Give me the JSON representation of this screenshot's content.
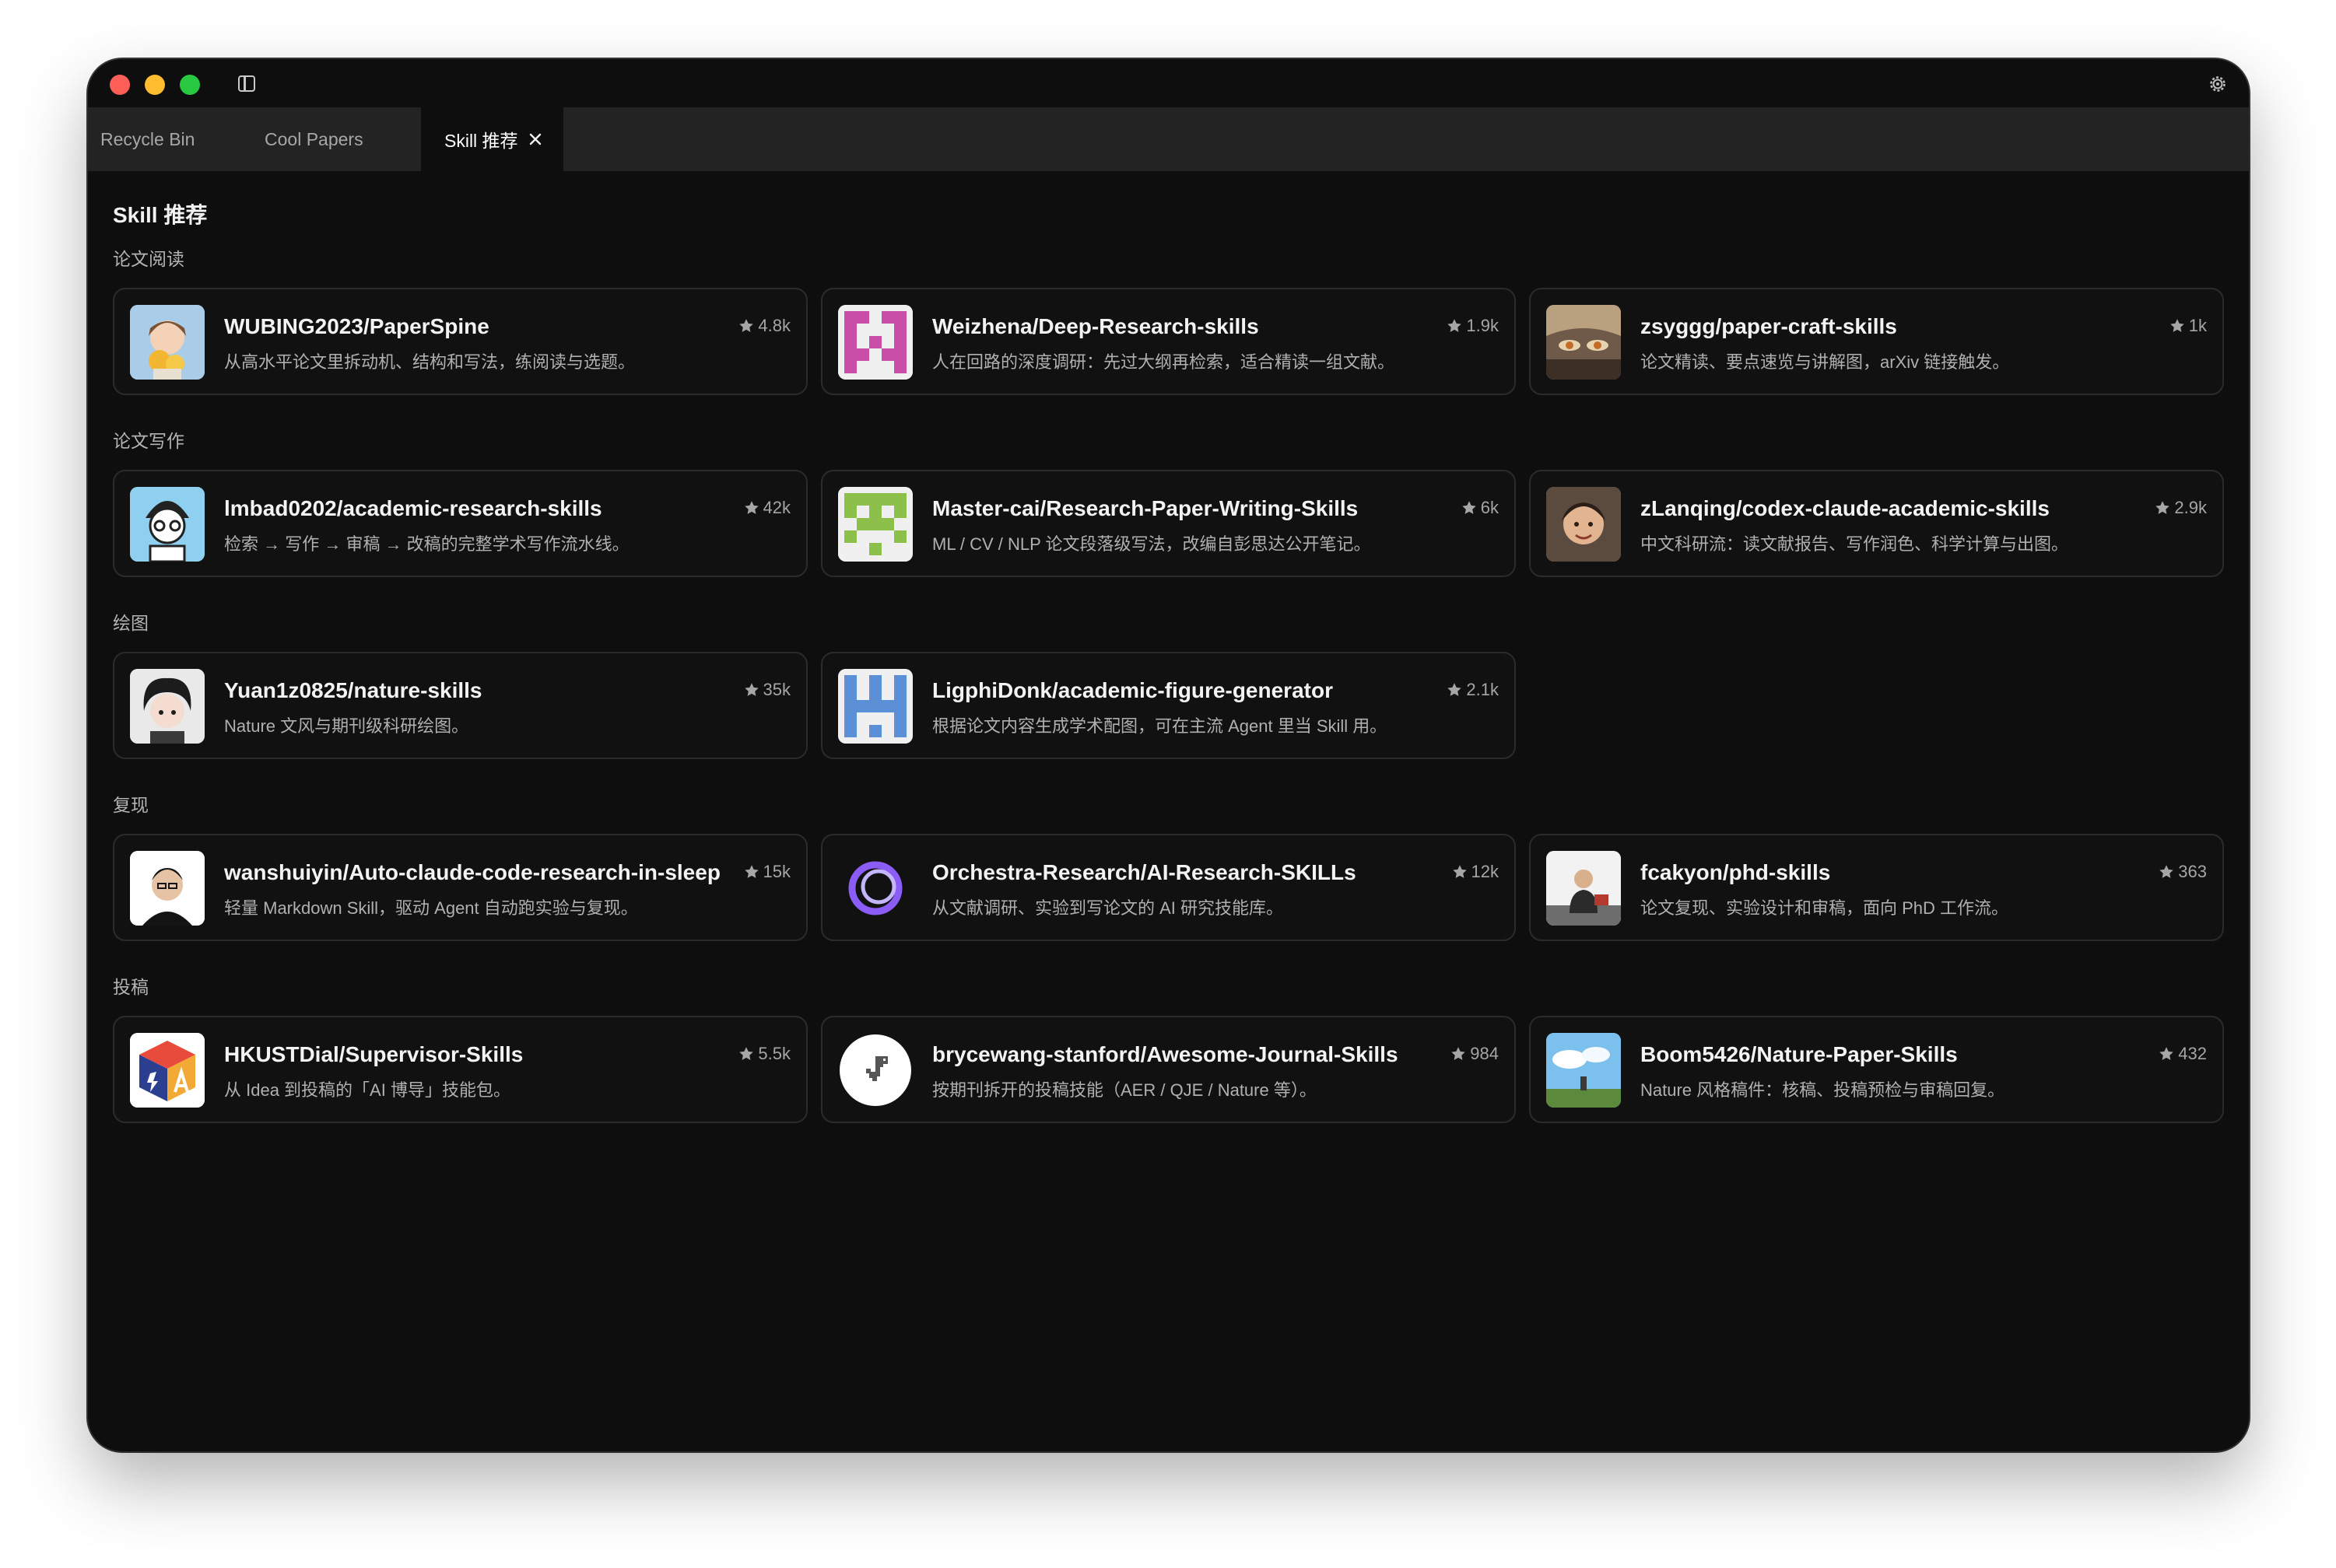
{
  "tabs": [
    {
      "label": "Recycle Bin"
    },
    {
      "label": "Cool Papers"
    },
    {
      "label": "Skill 推荐"
    }
  ],
  "page": {
    "title": "Skill 推荐"
  },
  "sections": [
    {
      "label": "论文阅读"
    },
    {
      "label": "论文写作"
    },
    {
      "label": "绘图"
    },
    {
      "label": "复现"
    },
    {
      "label": "投稿"
    }
  ],
  "cards": [
    {
      "title": "WUBING2023/PaperSpine",
      "desc": "从高水平论文里拆动机、结构和写法，练阅读与选题。",
      "stars": "4.8k",
      "icon": "anime-avatar-icon"
    },
    {
      "title": "Weizhena/Deep-Research-skills",
      "desc": "人在回路的深度调研：先过大纲再检索，适合精读一组文献。",
      "stars": "1.9k",
      "icon": "identicon-icon"
    },
    {
      "title": "zsyggg/paper-craft-skills",
      "desc": "论文精读、要点速览与讲解图，arXiv 链接触发。",
      "stars": "1k",
      "icon": "anime-avatar-icon"
    },
    {
      "title": "lmbad0202/academic-research-skills",
      "desc": "检索 → 写作 → 审稿 → 改稿的完整学术写作流水线。",
      "stars": "42k",
      "icon": "cartoon-avatar-icon"
    },
    {
      "title": "Master-cai/Research-Paper-Writing-Skills",
      "desc": "ML / CV / NLP 论文段落级写法，改编自彭思达公开笔记。",
      "stars": "6k",
      "icon": "identicon-icon"
    },
    {
      "title": "zLanqing/codex-claude-academic-skills",
      "desc": "中文科研流：读文献报告、写作润色、科学计算与出图。",
      "stars": "2.9k",
      "icon": "photo-avatar-icon"
    },
    {
      "title": "Yuan1z0825/nature-skills",
      "desc": "Nature 文风与期刊级科研绘图。",
      "stars": "35k",
      "icon": "anime-avatar-icon"
    },
    {
      "title": "LigphiDonk/academic-figure-generator",
      "desc": "根据论文内容生成学术配图，可在主流 Agent 里当 Skill 用。",
      "stars": "2.1k",
      "icon": "identicon-icon"
    },
    {
      "title": "wanshuiyin/Auto-claude-code-research-in-sleep",
      "desc": "轻量 Markdown Skill，驱动 Agent 自动跑实验与复现。",
      "stars": "15k",
      "icon": "photo-avatar-icon"
    },
    {
      "title": "Orchestra-Research/AI-Research-SKILLs",
      "desc": "从文献调研、实验到写论文的 AI 研究技能库。",
      "stars": "12k",
      "icon": "ring-logo-icon"
    },
    {
      "title": "fcakyon/phd-skills",
      "desc": "论文复现、实验设计和审稿，面向 PhD 工作流。",
      "stars": "363",
      "icon": "photo-avatar-icon"
    },
    {
      "title": "HKUSTDial/Supervisor-Skills",
      "desc": "从 Idea 到投稿的「AI 博导」技能包。",
      "stars": "5.5k",
      "icon": "cube-logo-icon"
    },
    {
      "title": "brycewang-stanford/Awesome-Journal-Skills",
      "desc": "按期刊拆开的投稿技能（AER / QJE / Nature 等）。",
      "stars": "984",
      "icon": "dino-avatar-icon"
    },
    {
      "title": "Boom5426/Nature-Paper-Skills",
      "desc": "Nature 风格稿件：核稿、投稿预检与审稿回复。",
      "stars": "432",
      "icon": "sky-avatar-icon"
    }
  ],
  "colors": {
    "window_bg": "#0e0e0e",
    "tabbar_bg": "#232323",
    "card_border": "#2b2b2b",
    "traffic_red": "#ff5f57",
    "traffic_yellow": "#febc2e",
    "traffic_green": "#28c840"
  }
}
